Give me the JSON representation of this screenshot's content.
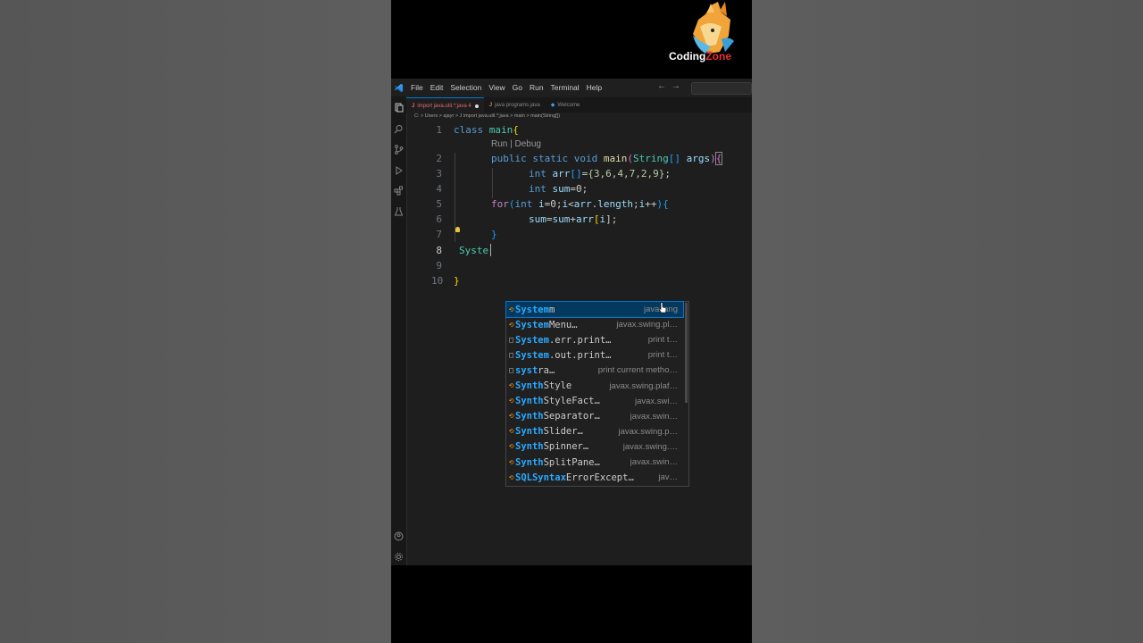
{
  "menu": {
    "items": [
      "File",
      "Edit",
      "Selection",
      "View",
      "Go",
      "Run",
      "Terminal",
      "Help"
    ]
  },
  "tabs": [
    {
      "label": "import java.util.*;java 4",
      "kind": "java",
      "active": true,
      "modified": true
    },
    {
      "label": "java programs.java",
      "kind": "java",
      "active": false
    },
    {
      "label": "Welcome",
      "kind": "vscode",
      "active": false
    }
  ],
  "breadcrumb": "C: > Users > ajayr > J import java.util.*;java > main > main(String[])",
  "code_lens": "Run | Debug",
  "line_numbers": [
    "1",
    "2",
    "3",
    "4",
    "5",
    "6",
    "7",
    "8",
    "9",
    "10"
  ],
  "code": {
    "l1": [
      "class",
      "main",
      "{"
    ],
    "l2": [
      "public",
      "static",
      "void",
      "main",
      "(",
      "String",
      "[]",
      "args",
      ")",
      "{"
    ],
    "l3": [
      "int",
      "arr",
      "[]",
      "=",
      "{3,6,4,7,2,9}",
      ";"
    ],
    "l4": [
      "int",
      "sum",
      "=0;"
    ],
    "l5": [
      "for",
      "(",
      "int",
      "i",
      "=0;",
      "i",
      "<",
      "arr",
      ".",
      "length",
      ";",
      "i",
      "++",
      ")",
      "{"
    ],
    "l6": [
      "sum",
      "=",
      "sum",
      "+",
      "arr",
      "[",
      "i",
      "];"
    ],
    "l7": "}",
    "l8": "Syste",
    "l10": "}"
  },
  "suggestions": [
    {
      "prefix": "System",
      "rest": "m",
      "label_full": "System",
      "detail": "java.lang",
      "icon": "class-icon",
      "selected": true
    },
    {
      "prefix": "System",
      "rest": "Menu…",
      "detail": "javax.swing.pl…",
      "icon": "class-icon"
    },
    {
      "prefix": "System",
      "rest": ".err.print…",
      "detail": "print t…",
      "icon": "snippet-icon"
    },
    {
      "prefix": "System",
      "rest": ".out.print…",
      "detail": "print t…",
      "icon": "snippet-icon"
    },
    {
      "prefix": "syst",
      "rest": "ra…",
      "detail": "print current metho…",
      "icon": "snippet-icon"
    },
    {
      "prefix": "Synth",
      "rest": "Style",
      "detail": "javax.swing.plaf…",
      "icon": "class-icon"
    },
    {
      "prefix": "Synth",
      "rest": "StyleFact…",
      "detail": "javax.swi…",
      "icon": "class-icon"
    },
    {
      "prefix": "Synth",
      "rest": "Separator…",
      "detail": "javax.swin…",
      "icon": "class-icon"
    },
    {
      "prefix": "Synth",
      "rest": "Slider…",
      "detail": "javax.swing.p…",
      "icon": "class-icon"
    },
    {
      "prefix": "Synth",
      "rest": "Spinner…",
      "detail": "javax.swing.…",
      "icon": "class-icon"
    },
    {
      "prefix": "Synth",
      "rest": "SplitPane…",
      "detail": "javax.swin…",
      "icon": "class-icon"
    },
    {
      "prefix": "SQLSyntax",
      "rest": "ErrorExcept…",
      "detail": "jav…",
      "icon": "class-icon"
    }
  ],
  "watermark": {
    "text_a": "Coding",
    "text_b": "Zone"
  },
  "colors": {
    "accent": "#0078d4",
    "selection": "#04395e",
    "keyword": "#569cd6",
    "type": "#4ec9b0",
    "function": "#dcdcaa"
  }
}
